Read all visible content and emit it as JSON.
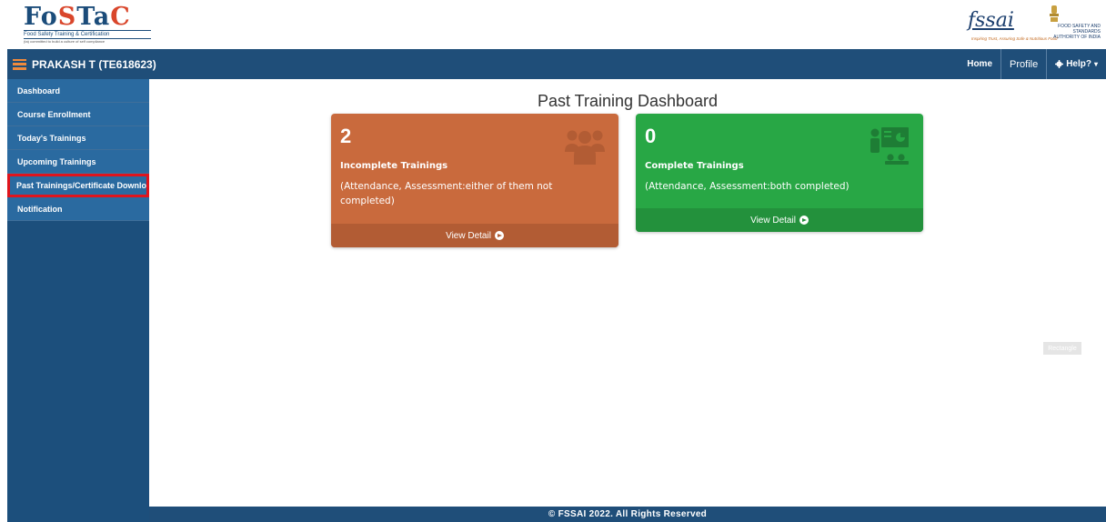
{
  "header": {
    "logo_left": {
      "brand_prefix": "Fo",
      "brand_s": "S",
      "brand_t": "T",
      "brand_a": "a",
      "brand_c": "C",
      "subtitle": "Food Safety Training & Certification",
      "tagline": "(ta) committed to build a culture of self compliance"
    },
    "logo_right": {
      "fssai": "fssai",
      "authority": "FOOD SAFETY AND STANDARDS AUTHORITY OF INDIA",
      "slogan": "Inspiring Trust, Assuring Safe & Nutritious Food"
    }
  },
  "navbar": {
    "user": "PRAKASH T (TE618623)",
    "links": {
      "home": "Home",
      "profile": "Profile",
      "help": "Help?"
    }
  },
  "sidebar": {
    "items": [
      {
        "label": "Dashboard"
      },
      {
        "label": "Course Enrollment"
      },
      {
        "label": "Today's Trainings"
      },
      {
        "label": "Upcoming Trainings"
      },
      {
        "label": "Past Trainings/Certificate Download"
      },
      {
        "label": "Notification"
      }
    ]
  },
  "main": {
    "title": "Past Training Dashboard",
    "cards": [
      {
        "count": "2",
        "label": "Incomplete Trainings",
        "description": "(Attendance, Assessment:either of them not completed)",
        "link": "View Detail",
        "color": "#c96a3d",
        "icon": "users-icon"
      },
      {
        "count": "0",
        "label": "Complete Trainings",
        "description": "(Attendance, Assessment:both completed)",
        "link": "View Detail",
        "color": "#28a745",
        "icon": "presentation-icon"
      }
    ],
    "rectangle_label": "Rectangle"
  },
  "footer": {
    "copyright": "© FSSAI 2022. All Rights Reserved"
  }
}
